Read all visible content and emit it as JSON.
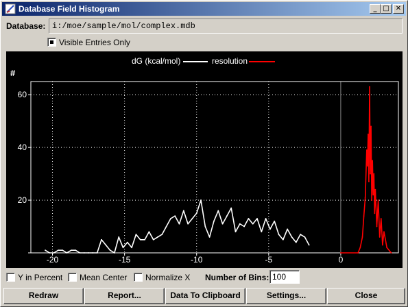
{
  "window": {
    "title": "Database Field Histogram",
    "controls": {
      "minimize": "_",
      "maximize": "□",
      "close": "✕"
    }
  },
  "database": {
    "label": "Database:",
    "path": "i:/moe/sample/mol/complex.mdb"
  },
  "visible_entries": {
    "label": "Visible Entries Only",
    "checked": true
  },
  "options": {
    "y_percent": {
      "label": "Y in Percent",
      "checked": false
    },
    "mean_center": {
      "label": "Mean Center",
      "checked": false
    },
    "normalize_x": {
      "label": "Normalize X",
      "checked": false
    },
    "bins_label": "Number of Bins:",
    "bins_value": "100"
  },
  "buttons": {
    "redraw": "Redraw",
    "report": "Report...",
    "clipboard": "Data To Clipboard",
    "settings": "Settings...",
    "close": "Close"
  },
  "chart_data": {
    "type": "line",
    "title": "",
    "ylabel": "#",
    "xlabel": "",
    "xlim": [
      -21.5,
      4.0
    ],
    "ylim": [
      0,
      65
    ],
    "x_ticks": [
      -20,
      -15,
      -10,
      -5,
      0
    ],
    "y_ticks": [
      0,
      20,
      40,
      60
    ],
    "y_tick_labels": [
      "20",
      "40",
      "60"
    ],
    "grid": true,
    "legend_position": "top-center",
    "colors": {
      "background": "#000000",
      "axis": "#ffffff",
      "grid": "#ffffff",
      "zero_line": "#888888"
    },
    "series": [
      {
        "name": "dG (kcal/mol)",
        "color": "#ffffff",
        "x": [
          -20.5,
          -20.2,
          -19.9,
          -19.6,
          -19.3,
          -19.0,
          -18.7,
          -18.4,
          -18.1,
          -17.8,
          -17.5,
          -17.2,
          -16.9,
          -16.6,
          -16.3,
          -16.0,
          -15.7,
          -15.4,
          -15.1,
          -14.8,
          -14.5,
          -14.2,
          -13.9,
          -13.6,
          -13.3,
          -13.0,
          -12.7,
          -12.4,
          -12.1,
          -11.8,
          -11.5,
          -11.2,
          -10.9,
          -10.6,
          -10.3,
          -10.0,
          -9.7,
          -9.4,
          -9.1,
          -8.8,
          -8.5,
          -8.2,
          -7.9,
          -7.6,
          -7.3,
          -7.0,
          -6.7,
          -6.4,
          -6.1,
          -5.8,
          -5.5,
          -5.2,
          -4.9,
          -4.6,
          -4.3,
          -4.0,
          -3.7,
          -3.4,
          -3.1,
          -2.8,
          -2.5,
          -2.2
        ],
        "y": [
          1,
          0,
          0,
          1,
          1,
          0,
          1,
          1,
          0,
          0,
          0,
          0,
          0,
          5,
          3,
          1,
          0,
          6,
          2,
          4,
          2,
          7,
          5,
          5,
          8,
          5,
          6,
          7,
          10,
          13,
          14,
          11,
          16,
          11,
          13,
          15,
          20,
          10,
          6,
          12,
          16,
          11,
          14,
          17,
          8,
          11,
          10,
          13,
          11,
          13,
          8,
          13,
          9,
          12,
          7,
          5,
          9,
          6,
          4,
          7,
          6,
          3
        ],
        "x_shown": [
          -20.5,
          -2.2
        ]
      },
      {
        "name": "resolution",
        "color": "#ff0000",
        "x": [
          0.0,
          1.2,
          1.35,
          1.5,
          1.6,
          1.7,
          1.8,
          1.85,
          1.9,
          1.95,
          2.0,
          2.05,
          2.1,
          2.15,
          2.2,
          2.25,
          2.3,
          2.35,
          2.4,
          2.5,
          2.6,
          2.7,
          2.8,
          2.9,
          3.0,
          3.2,
          3.5
        ],
        "y": [
          0,
          0,
          2,
          6,
          14,
          21,
          39,
          33,
          45,
          27,
          63,
          30,
          48,
          20,
          35,
          22,
          30,
          15,
          24,
          10,
          20,
          6,
          13,
          3,
          8,
          2,
          0
        ]
      }
    ]
  }
}
